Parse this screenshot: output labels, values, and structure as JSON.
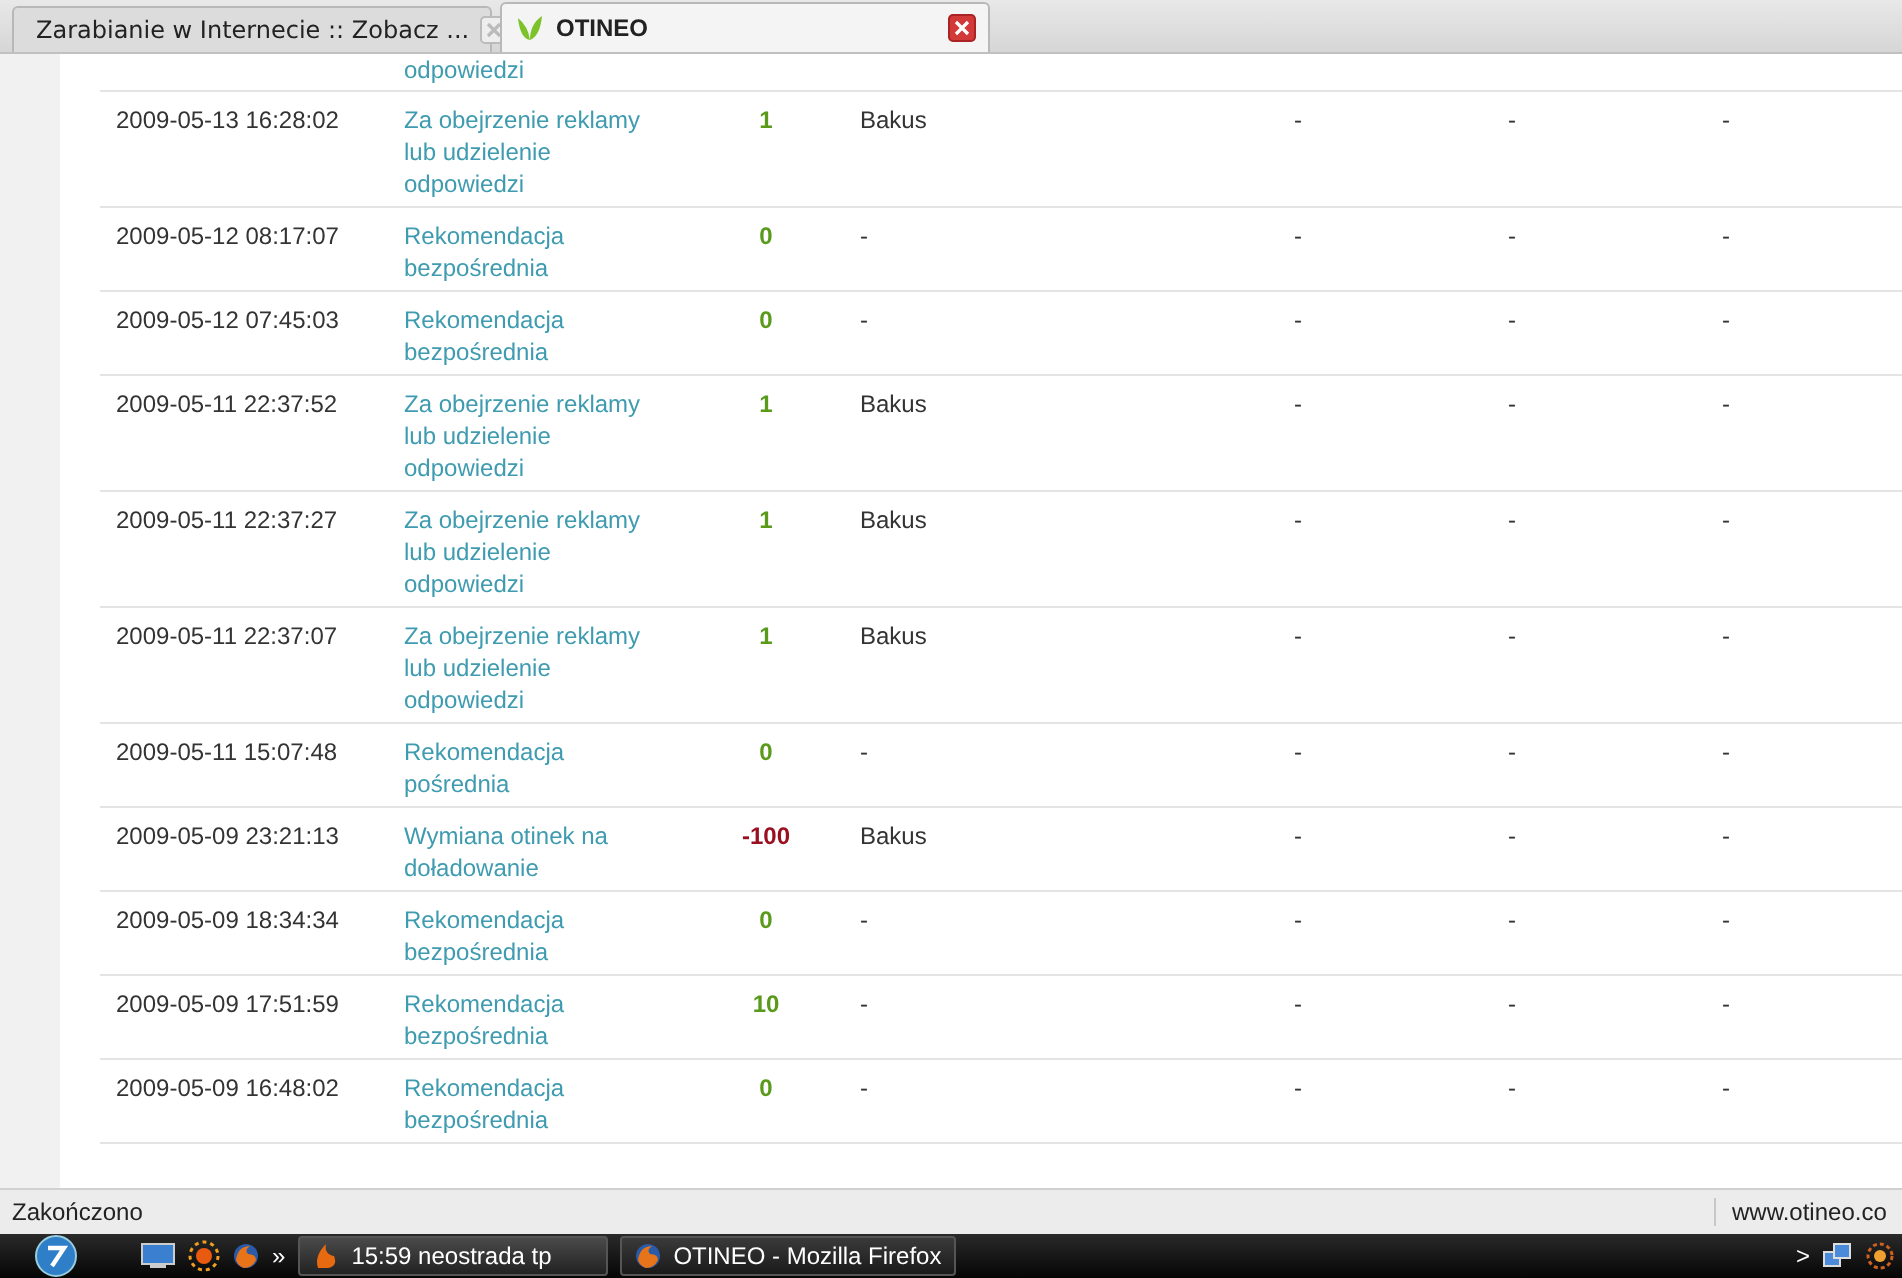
{
  "tabs": [
    {
      "title": "Zarabianie w Internecie :: Zobacz ...",
      "selected": false
    },
    {
      "title": "OTINEO",
      "selected": true
    }
  ],
  "table": {
    "top_fragment": "odpowiedzi",
    "rows": [
      {
        "date": "2009-05-13 16:28:02",
        "type": "Za obejrzenie reklamy lub udzielenie odpowiedzi",
        "points": "1",
        "color": "#5a9a1a",
        "user": "Bakus",
        "column_5": "-",
        "column_6": "-",
        "column_7": "-"
      },
      {
        "date": "2009-05-12 08:17:07",
        "type": "Rekomendacja bezpośrednia",
        "points": "0",
        "color": "#5a9a1a",
        "user": "-",
        "column_5": "-",
        "column_6": "-",
        "column_7": "-"
      },
      {
        "date": "2009-05-12 07:45:03",
        "type": "Rekomendacja bezpośrednia",
        "points": "0",
        "color": "#5a9a1a",
        "user": "-",
        "column_5": "-",
        "column_6": "-",
        "column_7": "-"
      },
      {
        "date": "2009-05-11 22:37:52",
        "type": "Za obejrzenie reklamy lub udzielenie odpowiedzi",
        "points": "1",
        "color": "#5a9a1a",
        "user": "Bakus",
        "column_5": "-",
        "column_6": "-",
        "column_7": "-"
      },
      {
        "date": "2009-05-11 22:37:27",
        "type": "Za obejrzenie reklamy lub udzielenie odpowiedzi",
        "points": "1",
        "color": "#5a9a1a",
        "user": "Bakus",
        "column_5": "-",
        "column_6": "-",
        "column_7": "-"
      },
      {
        "date": "2009-05-11 22:37:07",
        "type": "Za obejrzenie reklamy lub udzielenie odpowiedzi",
        "points": "1",
        "color": "#5a9a1a",
        "user": "Bakus",
        "column_5": "-",
        "column_6": "-",
        "column_7": "-"
      },
      {
        "date": "2009-05-11 15:07:48",
        "type": "Rekomendacja pośrednia",
        "points": "0",
        "color": "#5a9a1a",
        "user": "-",
        "column_5": "-",
        "column_6": "-",
        "column_7": "-"
      },
      {
        "date": "2009-05-09 23:21:13",
        "type": "Wymiana otinek na doładowanie",
        "points": "-100",
        "color": "#9a1020",
        "user": "Bakus",
        "column_5": "-",
        "column_6": "-",
        "column_7": "-"
      },
      {
        "date": "2009-05-09 18:34:34",
        "type": "Rekomendacja bezpośrednia",
        "points": "0",
        "color": "#5a9a1a",
        "user": "-",
        "column_5": "-",
        "column_6": "-",
        "column_7": "-"
      },
      {
        "date": "2009-05-09 17:51:59",
        "type": "Rekomendacja bezpośrednia",
        "points": "10",
        "color": "#5a9a1a",
        "user": "-",
        "column_5": "-",
        "column_6": "-",
        "column_7": "-"
      },
      {
        "date": "2009-05-09 16:48:02",
        "type": "Rekomendacja bezpośrednia",
        "points": "0",
        "color": "#5a9a1a",
        "user": "-",
        "column_5": "-",
        "column_6": "-",
        "column_7": "-"
      }
    ]
  },
  "status_bar": {
    "text": "Zakończono",
    "url": "www.otineo.co"
  },
  "taskbar": {
    "tasks": [
      {
        "label": "15:59 neostrada tp",
        "selected": false
      },
      {
        "label": "OTINEO - Mozilla Firefox",
        "selected": true
      }
    ],
    "chevron": "»",
    "tray_chevron": ">"
  }
}
